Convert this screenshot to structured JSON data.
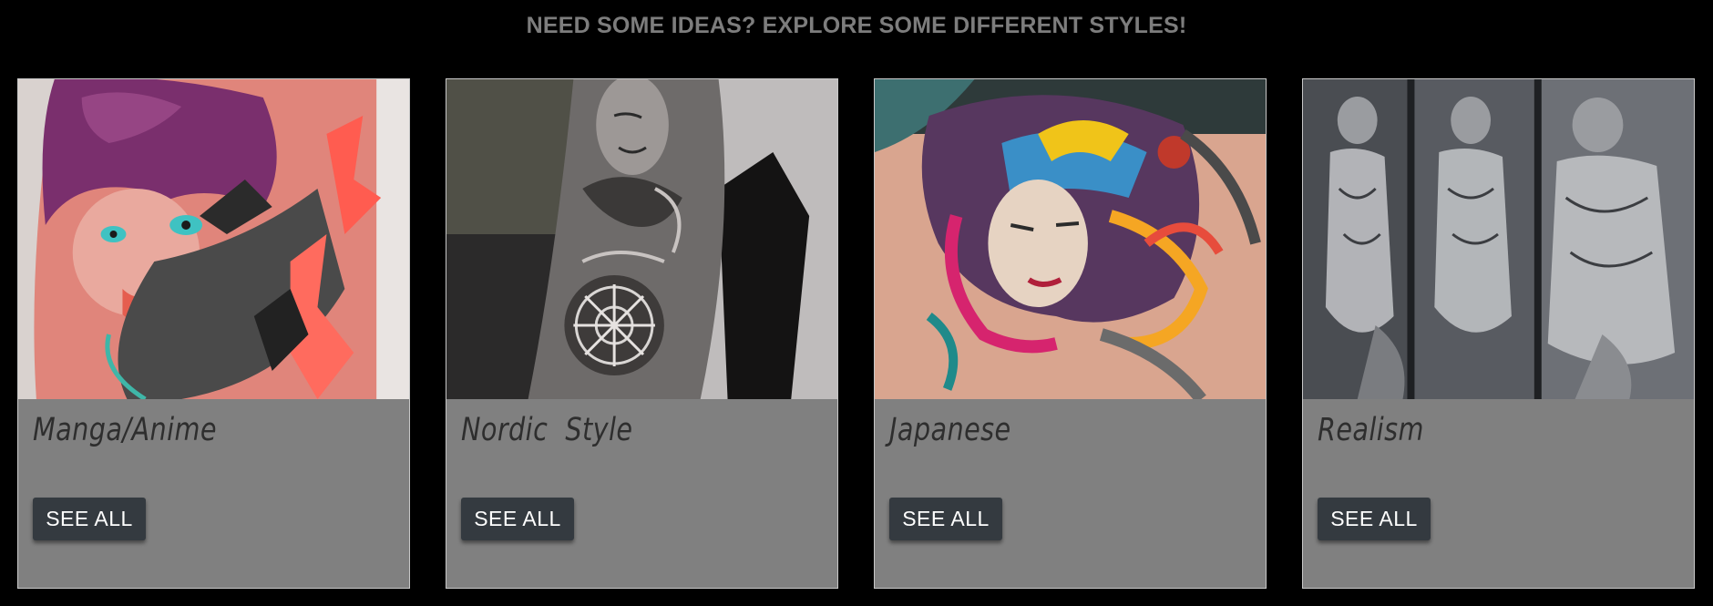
{
  "page": {
    "heading": "NEED SOME IDEAS? EXPLORE SOME DIFFERENT STYLES!"
  },
  "colors": {
    "background": "#000000",
    "heading": "#7d7d7d",
    "card": "#808080",
    "button": "#343a40",
    "button_text": "#ffffff",
    "title_text": "#2e2e2e"
  },
  "cards": [
    {
      "title": "Manga/Anime",
      "button_label": "SEE ALL",
      "image": "manga-anime-tattoo-photo"
    },
    {
      "title": "Nordic  Style",
      "button_label": "SEE ALL",
      "image": "nordic-sleeve-tattoo-photo"
    },
    {
      "title": "Japanese",
      "button_label": "SEE ALL",
      "image": "japanese-chest-tattoo-photo"
    },
    {
      "title": "Realism",
      "button_label": "SEE ALL",
      "image": "realism-statue-tattoo-photo"
    }
  ]
}
